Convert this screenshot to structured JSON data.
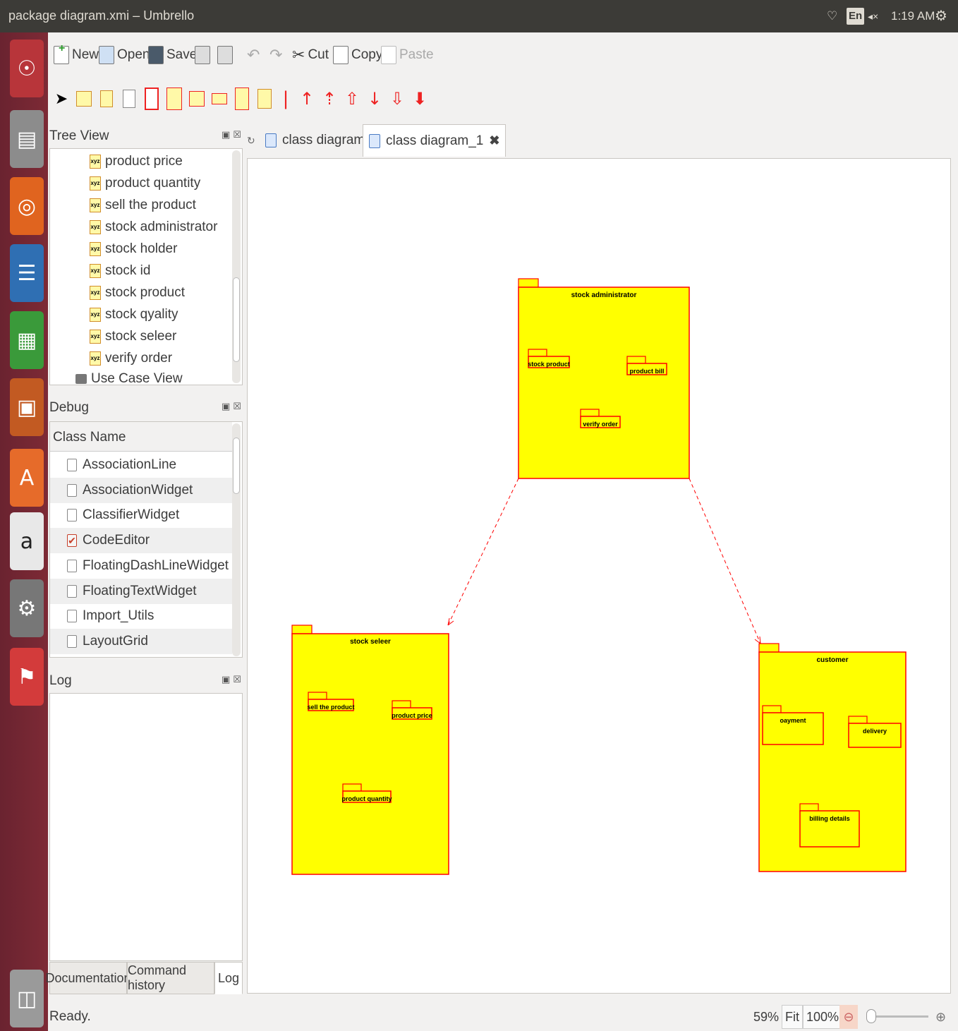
{
  "window": {
    "title": "package diagram.xmi – Umbrello"
  },
  "tray": {
    "keyboard": "En",
    "time": "1:19 AM"
  },
  "launcher": {
    "items": [
      "ubuntu-home-icon",
      "files-icon",
      "firefox-icon",
      "writer-icon",
      "calc-icon",
      "impress-icon",
      "software-center-icon",
      "amazon-icon",
      "settings-icon",
      "umbrello-icon",
      "trash-icon"
    ]
  },
  "toolbar": {
    "new_label": "New",
    "open_label": "Open",
    "save_label": "Save",
    "cut_label": "Cut",
    "copy_label": "Copy",
    "paste_label": "Paste"
  },
  "tree_view": {
    "title": "Tree View",
    "items": [
      "product price",
      "product quantity",
      "sell the product",
      "stock administrator",
      "stock holder",
      "stock id",
      "stock product",
      "stock qyality",
      "stock seleer",
      "verify order"
    ],
    "folder": "Use Case View"
  },
  "debug": {
    "title": "Debug",
    "header": "Class Name",
    "rows": [
      {
        "label": "AssociationLine",
        "checked": false
      },
      {
        "label": "AssociationWidget",
        "checked": false
      },
      {
        "label": "ClassifierWidget",
        "checked": false
      },
      {
        "label": "CodeEditor",
        "checked": true
      },
      {
        "label": "FloatingDashLineWidget",
        "checked": false
      },
      {
        "label": "FloatingTextWidget",
        "checked": false
      },
      {
        "label": "Import_Utils",
        "checked": false
      },
      {
        "label": "LayoutGrid",
        "checked": false
      }
    ]
  },
  "log": {
    "title": "Log"
  },
  "bottom_tabs": [
    "Documentation",
    "Command history",
    "Log"
  ],
  "diagram_tabs": [
    {
      "label": "class diagram",
      "active": false
    },
    {
      "label": "class diagram_1",
      "active": true
    }
  ],
  "diagram": {
    "packages": [
      {
        "name": "stock administrator",
        "children": [
          "stock product",
          "product bill",
          "verify order"
        ]
      },
      {
        "name": "stock seleer",
        "children": [
          "sell the product",
          "product price",
          "product quantity"
        ]
      },
      {
        "name": "customer",
        "children": [
          "oayment",
          "delivery",
          "billing details"
        ]
      }
    ],
    "colors": {
      "fill": "#ffff00",
      "line": "#ff0000"
    }
  },
  "status": {
    "text": "Ready.",
    "zoom": "59%",
    "fit_label": "Fit",
    "hundred_label": "100%"
  }
}
